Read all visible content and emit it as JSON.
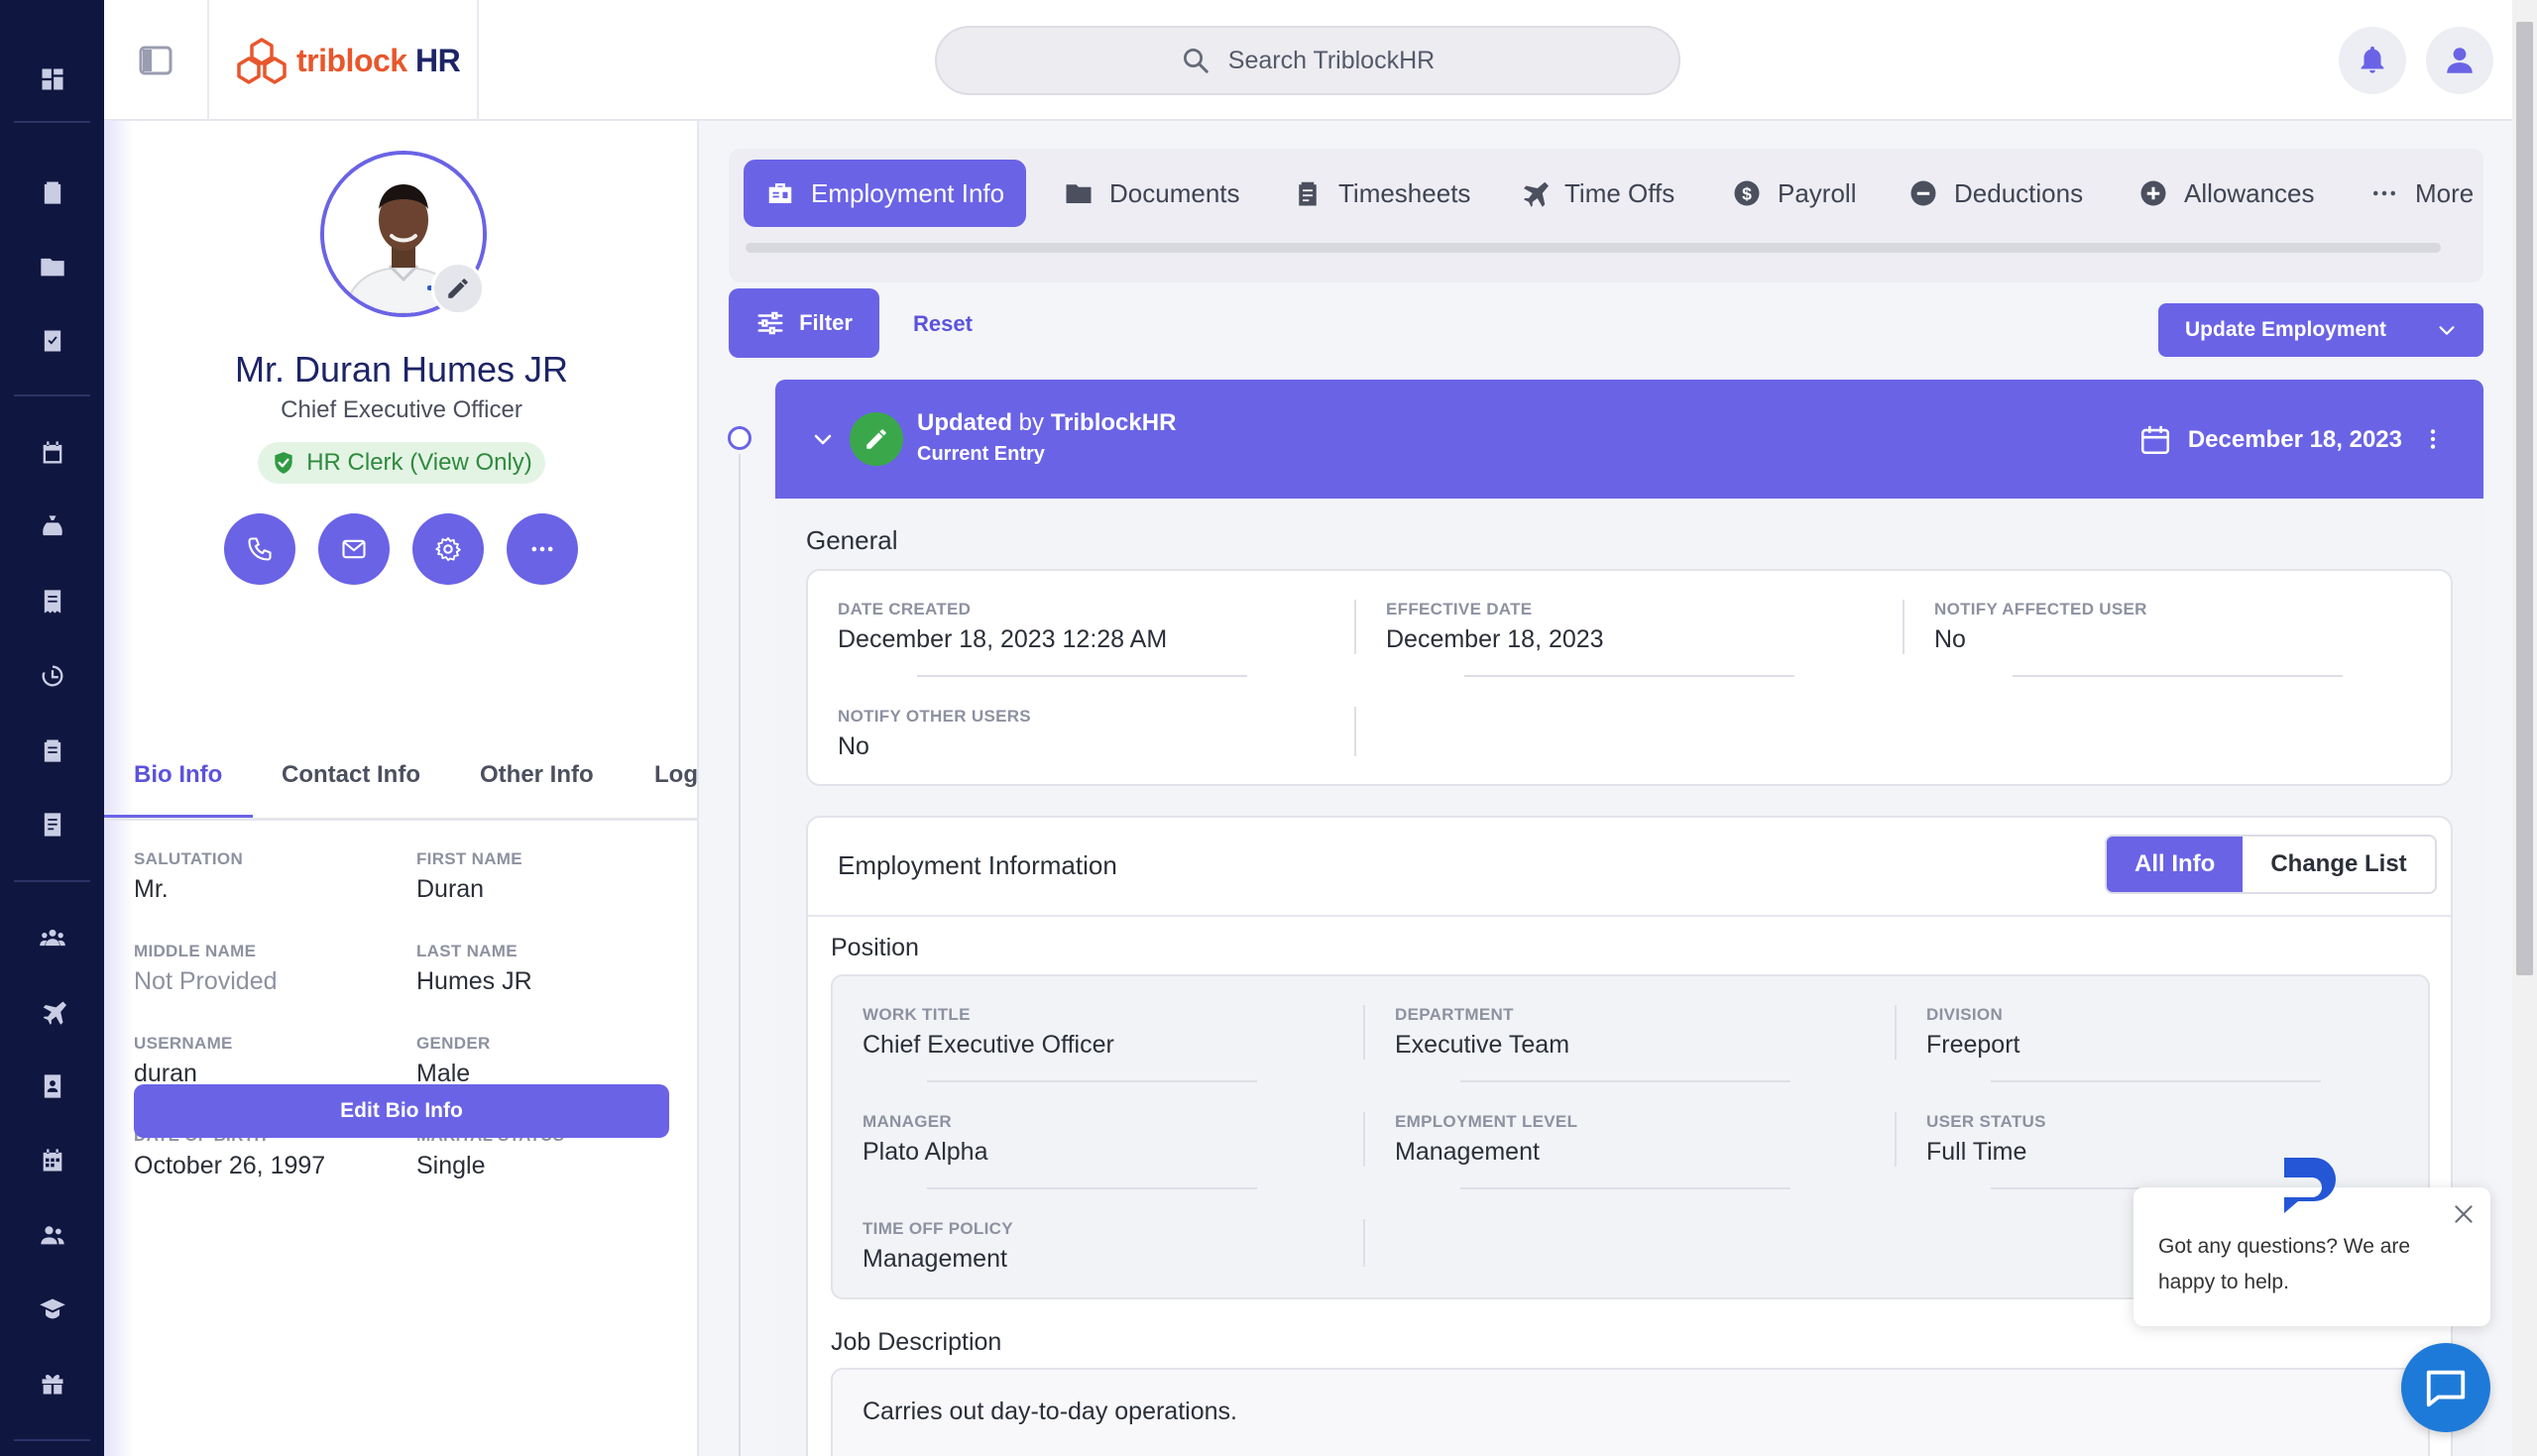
{
  "app": {
    "brand_prefix": "triblock",
    "brand_suffix": "HR",
    "search_placeholder": "Search TriblockHR"
  },
  "rail_icons": [
    "dashboard-icon",
    "clipboard-icon",
    "folder-icon",
    "checklist-icon",
    "calendar-icon",
    "money-bag-icon",
    "receipt-icon",
    "history-clock-icon",
    "report-icon",
    "document-icon",
    "team-icon",
    "plane-icon",
    "contacts-icon",
    "calendar-grid-icon",
    "users-icon",
    "graduation-icon",
    "gift-icon"
  ],
  "profile": {
    "name": "Mr. Duran Humes JR",
    "title": "Chief Executive Officer",
    "role_badge": "HR Clerk (View Only)",
    "tabs": [
      "Bio Info",
      "Contact Info",
      "Other Info",
      "Log"
    ],
    "active_tab": "Bio Info",
    "fields": [
      {
        "label": "SALUTATION",
        "value": "Mr."
      },
      {
        "label": "FIRST NAME",
        "value": "Duran"
      },
      {
        "label": "MIDDLE NAME",
        "value": "Not Provided"
      },
      {
        "label": "LAST NAME",
        "value": "Humes JR"
      },
      {
        "label": "USERNAME",
        "value": "duran"
      },
      {
        "label": "GENDER",
        "value": "Male"
      },
      {
        "label": "DATE OF BIRTH",
        "value": "October 26, 1997"
      },
      {
        "label": "MARITAL STATUS",
        "value": "Single"
      }
    ],
    "edit_button": "Edit Bio Info"
  },
  "main_tabs": [
    {
      "label": "Employment Info",
      "icon": "briefcase-icon",
      "active": true
    },
    {
      "label": "Documents",
      "icon": "folder-icon"
    },
    {
      "label": "Timesheets",
      "icon": "clipboard-icon"
    },
    {
      "label": "Time Offs",
      "icon": "plane-icon"
    },
    {
      "label": "Payroll",
      "icon": "dollar-icon"
    },
    {
      "label": "Deductions",
      "icon": "minus-circle-icon"
    },
    {
      "label": "Allowances",
      "icon": "plus-circle-icon"
    },
    {
      "label": "More",
      "icon": "ellipsis-icon"
    }
  ],
  "toolbar": {
    "filter": "Filter",
    "reset": "Reset",
    "update": "Update Employment"
  },
  "entry": {
    "updated_word": "Updated",
    "by_word": "by",
    "author": "TriblockHR",
    "subtitle": "Current Entry",
    "date": "December 18, 2023"
  },
  "general": {
    "title": "General",
    "fields": [
      {
        "label": "DATE CREATED",
        "value": "December 18, 2023 12:28 AM"
      },
      {
        "label": "EFFECTIVE DATE",
        "value": "December 18, 2023"
      },
      {
        "label": "NOTIFY AFFECTED USER",
        "value": "No"
      },
      {
        "label": "NOTIFY OTHER USERS",
        "value": "No"
      }
    ]
  },
  "employment": {
    "title": "Employment Information",
    "toggle": [
      "All Info",
      "Change List"
    ],
    "position_title": "Position",
    "fields": [
      {
        "label": "WORK TITLE",
        "value": "Chief Executive Officer"
      },
      {
        "label": "DEPARTMENT",
        "value": "Executive Team"
      },
      {
        "label": "DIVISION",
        "value": "Freeport"
      },
      {
        "label": "MANAGER",
        "value": "Plato Alpha"
      },
      {
        "label": "EMPLOYMENT LEVEL",
        "value": "Management"
      },
      {
        "label": "USER STATUS",
        "value": "Full Time"
      },
      {
        "label": "TIME OFF POLICY",
        "value": "Management"
      }
    ],
    "job_title": "Job Description",
    "job_text": "Carries out day-to-day operations."
  },
  "chat": {
    "message": "Got any questions? We are happy to help."
  },
  "colors": {
    "accent": "#6a63e6",
    "rail": "#0f1640",
    "brand_orange": "#e8562c",
    "success": "#3aa84a"
  }
}
